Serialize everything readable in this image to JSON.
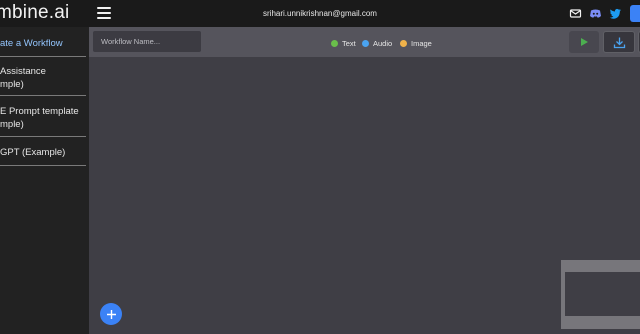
{
  "header": {
    "logo_text": "mbine.ai",
    "user_email": "srihari.unnikrishnan@gmail.com",
    "icons": [
      "menu-icon",
      "mail-icon",
      "discord-icon",
      "twitter-icon"
    ]
  },
  "sidebar": {
    "items": [
      {
        "line1": "ate a Workflow",
        "line2": "",
        "active": true
      },
      {
        "line1": " Assistance",
        "line2": "mple)",
        "active": false
      },
      {
        "line1": "E Prompt template",
        "line2": "mple)",
        "active": false
      },
      {
        "line1": "GPT (Example)",
        "line2": "",
        "active": false
      }
    ]
  },
  "toolbar": {
    "workflow_name_placeholder": "Workflow Name...",
    "legend": [
      {
        "label": "Text",
        "color": "#6abf4b"
      },
      {
        "label": "Audio",
        "color": "#4aa3f0"
      },
      {
        "label": "Image",
        "color": "#f0b24a"
      }
    ],
    "run_icon": "play-icon",
    "download_icon": "download-icon"
  },
  "canvas": {
    "add_button_icon": "plus-icon"
  },
  "colors": {
    "accent": "#3b82f6",
    "run_green": "#4caf50"
  }
}
